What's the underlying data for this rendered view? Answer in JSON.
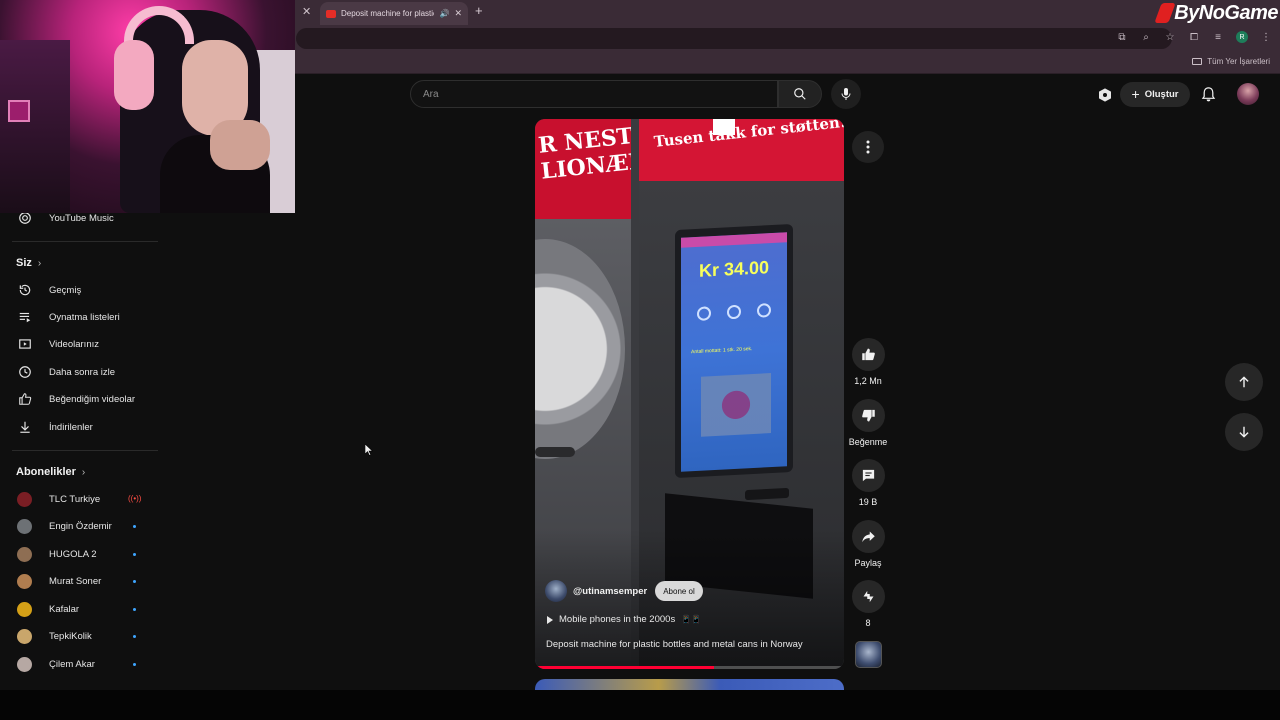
{
  "browser": {
    "tab_title": "Deposit machine for plastic bottles and metal cans in Norway",
    "bookmarks_all": "Tüm Yer İşaretleri",
    "profile_initial": "R"
  },
  "watermark": {
    "text": "ByNoGame"
  },
  "masthead": {
    "search_placeholder": "Ara",
    "create_label": "Oluştur"
  },
  "sidebar": {
    "top_items": [
      {
        "label": "YouTube Music",
        "icon": "youtube-music-icon"
      }
    ],
    "you_section": {
      "title": "Siz",
      "items": [
        {
          "label": "Geçmiş",
          "icon": "history-icon"
        },
        {
          "label": "Oynatma listeleri",
          "icon": "playlists-icon"
        },
        {
          "label": "Videolarınız",
          "icon": "your-videos-icon"
        },
        {
          "label": "Daha sonra izle",
          "icon": "watch-later-icon"
        },
        {
          "label": "Beğendiğim videolar",
          "icon": "liked-videos-icon"
        },
        {
          "label": "İndirilenler",
          "icon": "downloads-icon"
        }
      ]
    },
    "subscriptions": {
      "title": "Abonelikler",
      "items": [
        {
          "name": "TLC Turkiye",
          "status": "live",
          "color": "#c0392b"
        },
        {
          "name": "Engin Özdemir",
          "status": "new",
          "color": "#7f8c8d"
        },
        {
          "name": "HUGOLA 2",
          "status": "new",
          "color": "#8e6e53"
        },
        {
          "name": "Murat Soner",
          "status": "new",
          "color": "#b07d4f"
        },
        {
          "name": "Kafalar",
          "status": "new",
          "color": "#d4a017"
        },
        {
          "name": "TepkiKolik",
          "status": "new",
          "color": "#c9a66b"
        },
        {
          "name": "Çilem Akar",
          "status": "new",
          "color": "#b6a8a3"
        }
      ]
    }
  },
  "short": {
    "scene": {
      "banner_left": "R NESTE\nLIONÆR?",
      "banner_right": "Tusen takk for støtten!",
      "screen_amount": "Kr 34.00",
      "screen_sub": "Antall mottatt: 1 stk. 20 sek."
    },
    "channel_handle": "@utinamsemper",
    "subscribe_label": "Abone ol",
    "music_label": "Mobile phones in the 2000s",
    "music_emoji": "📱📱",
    "title": "Deposit machine for plastic bottles and metal cans in Norway",
    "progress": 0.58
  },
  "actions": {
    "like_count": "1,2 Mn",
    "dislike_label": "Beğenme",
    "comment_count": "19 B",
    "share_label": "Paylaş",
    "remix_count": "8"
  },
  "colors": {
    "accent_red": "#ff0033",
    "background": "#0f0f0f",
    "chip": "#272727"
  }
}
